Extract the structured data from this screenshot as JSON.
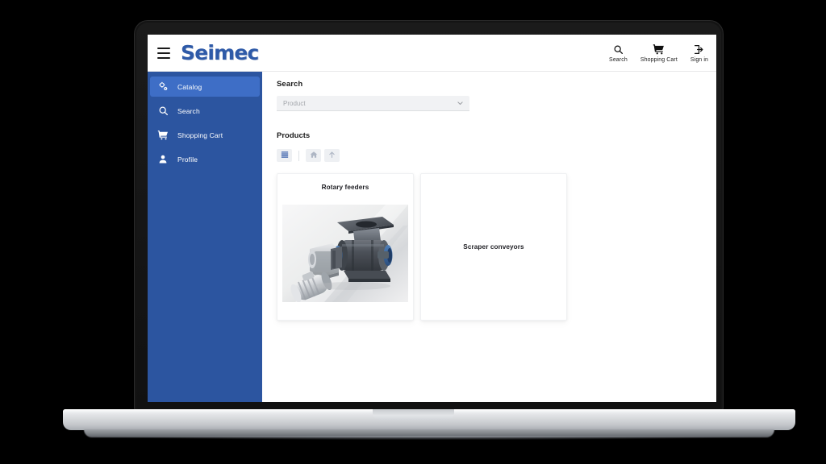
{
  "device": {
    "type": "laptop-mockup"
  },
  "app": {
    "brand": "Seimec",
    "menu_icon": "hamburger-icon",
    "header_actions": [
      {
        "icon": "search-icon",
        "label": "Search"
      },
      {
        "icon": "shopping-cart-icon",
        "label": "Shopping Cart"
      },
      {
        "icon": "sign-in-icon",
        "label": "Sign in"
      }
    ]
  },
  "sidebar": {
    "items": [
      {
        "icon": "catalog-gear-icon",
        "label": "Catalog",
        "active": true
      },
      {
        "icon": "search-icon",
        "label": "Search",
        "active": false
      },
      {
        "icon": "shopping-cart-icon",
        "label": "Shopping Cart",
        "active": false
      },
      {
        "icon": "profile-user-icon",
        "label": "Profile",
        "active": false
      }
    ]
  },
  "main": {
    "search_heading": "Search",
    "product_select": {
      "placeholder": "Product",
      "value": "",
      "chevron": "chevron-down-icon"
    },
    "products_heading": "Products",
    "toolbar": [
      {
        "icon": "list-view-icon",
        "state": "active"
      },
      {
        "icon": "home-icon",
        "state": "muted"
      },
      {
        "icon": "upload-arrow-icon",
        "state": "muted"
      }
    ],
    "cards": [
      {
        "title": "Rotary feeders",
        "has_image": true,
        "image": "rotary-feeder-machine-photo"
      },
      {
        "title": "Scraper conveyors",
        "has_image": false,
        "image": ""
      }
    ]
  },
  "colors": {
    "sidebar": "#2c55a0",
    "sidebar_active": "#3e6ec6",
    "brand": "#2e5aa8",
    "bezel": "#141414",
    "page_bg": "#ffffff"
  }
}
